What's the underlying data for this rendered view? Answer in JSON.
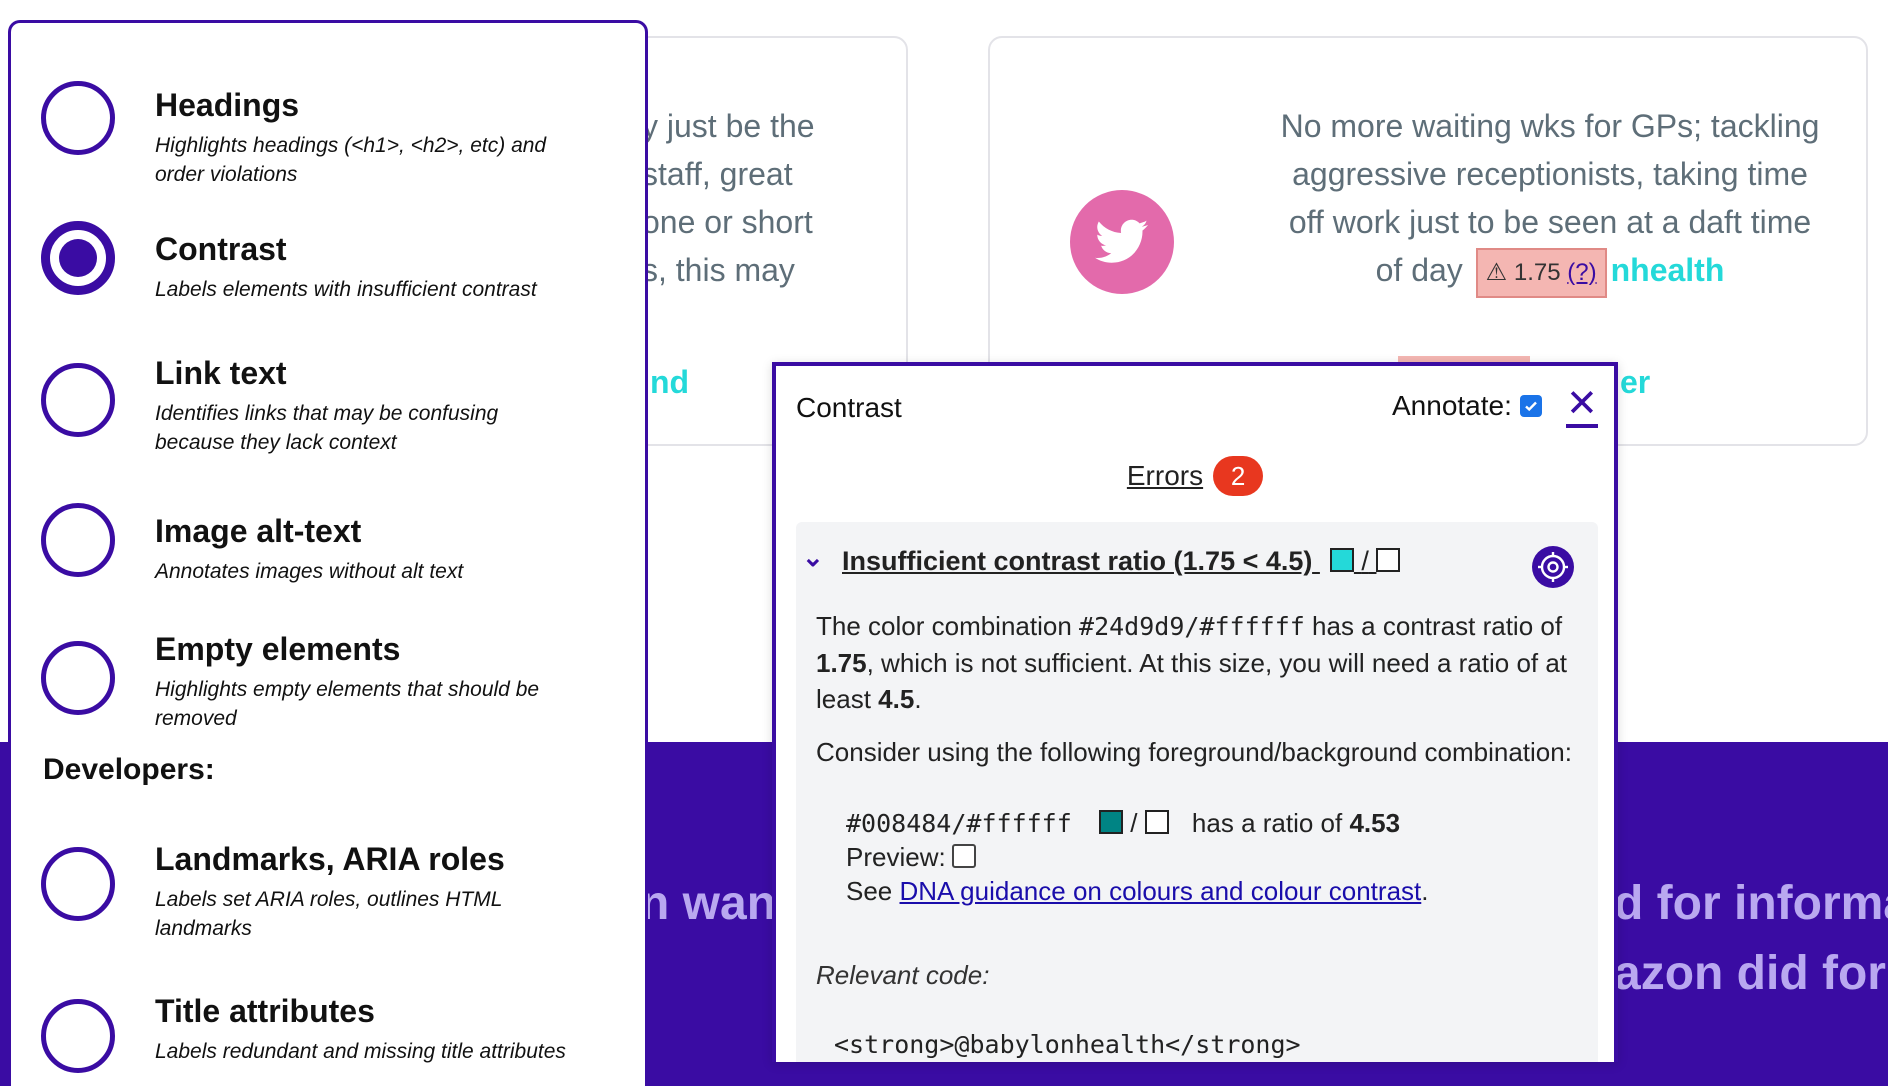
{
  "page": {
    "card1": {
      "text_lines": [
        "y just be the",
        "staff, great",
        "one or short",
        "s, this may",
        "."
      ],
      "link": "nd"
    },
    "card2": {
      "text_line1": "No more waiting wks for GPs; tackling",
      "text_line2": "aggressive receptionists, taking time",
      "text_line3": "off work just to be seen at a daft time",
      "text_prefix": "of day",
      "warning_value": "1.75",
      "warning_help": "(?)",
      "strong_text": "nhealth",
      "link": "er",
      "twitter_icon": "twitter-bird-icon",
      "bubble_color": "#e36aab"
    },
    "band": {
      "left_text": "n want",
      "right_line1": "d for informa",
      "right_line2": "azon did for",
      "color": "#3a0ca3"
    }
  },
  "panel": {
    "options": [
      {
        "title": "Headings",
        "desc": "Highlights headings (<h1>, <h2>, etc) and order violations",
        "selected": false
      },
      {
        "title": "Contrast",
        "desc": "Labels elements with insufficient contrast",
        "selected": true
      },
      {
        "title": "Link text",
        "desc": "Identifies links that may be confusing because they lack context",
        "selected": false
      },
      {
        "title": "Image alt-text",
        "desc": "Annotates images without alt text",
        "selected": false
      },
      {
        "title": "Empty elements",
        "desc": "Highlights empty elements that should be removed",
        "selected": false
      }
    ],
    "developers_heading": "Developers:",
    "dev_options": [
      {
        "title": "Landmarks, ARIA roles",
        "desc": "Labels set ARIA roles, outlines HTML landmarks",
        "selected": false
      },
      {
        "title": "Title attributes",
        "desc": "Labels redundant and missing title attributes",
        "selected": false
      }
    ]
  },
  "popup": {
    "title": "Contrast",
    "annotate_label": "Annotate:",
    "annotate_checked": true,
    "close_label": "✕",
    "errors_label": "Errors",
    "errors_count": "2",
    "issue": {
      "title": "Insufficient contrast ratio (1.75 < 4.5)",
      "fg_color": "#24d9d9",
      "bg_color": "#ffffff",
      "desc_part1": "The color combination ",
      "desc_colors": "#24d9d9/#ffffff",
      "desc_part2": " has a contrast ratio of ",
      "desc_ratio": "1.75",
      "desc_part3": ", which is not sufficient. At this size, you will need a ratio of at least ",
      "desc_required": "4.5",
      "desc_end": ".",
      "consider": "Consider using the following foreground/background combination:",
      "suggestion_colors": "#008484/#ffffff",
      "suggestion_fg": "#008484",
      "suggestion_ratio_label": "has a ratio of",
      "suggestion_ratio": "4.53",
      "preview_label": "Preview:",
      "see_label": "See",
      "guidance_link": "DNA guidance on colours and colour contrast",
      "relevant_code_label": "Relevant code:",
      "code": "<strong>@babylonhealth</strong>"
    }
  }
}
